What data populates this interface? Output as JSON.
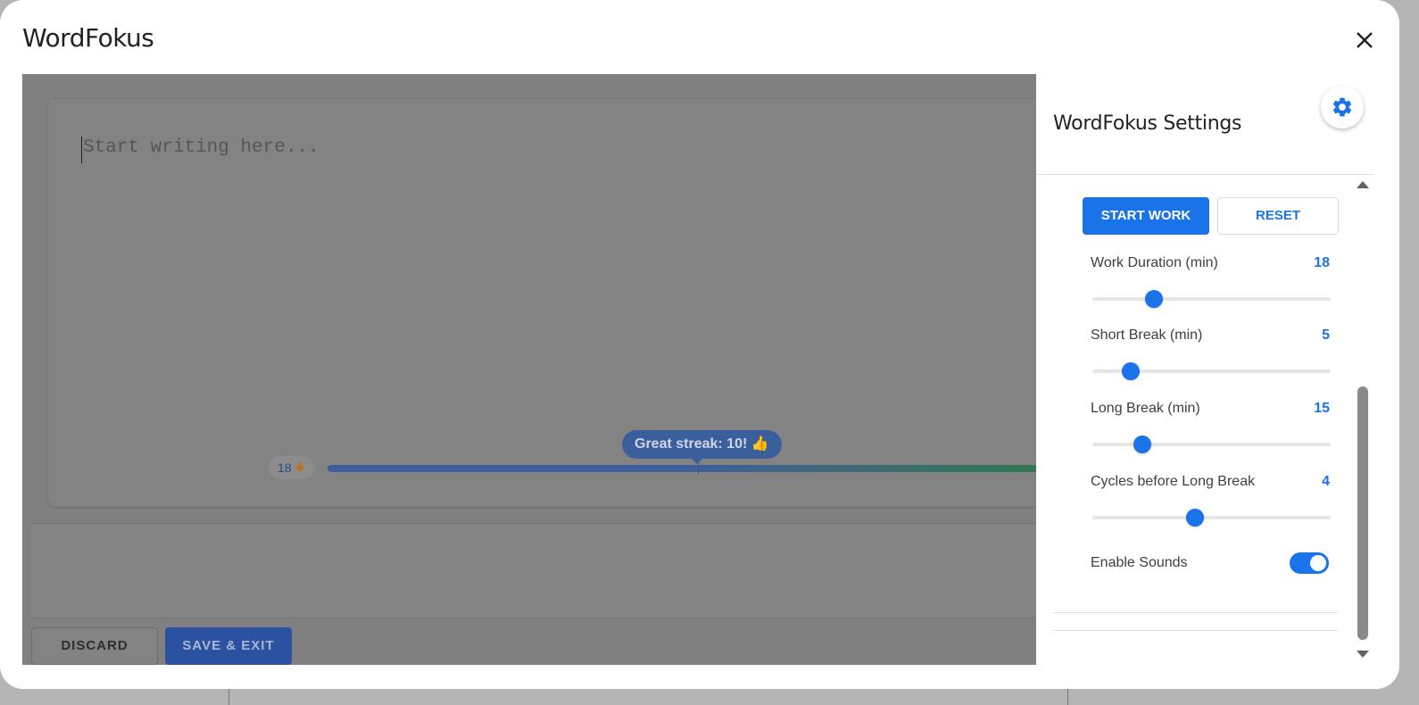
{
  "dialog": {
    "title": "WordFokus"
  },
  "editor": {
    "placeholder": "Start writing here...",
    "streak_count": "18",
    "streak_icon": "flame-icon",
    "streak_tooltip": "Great streak: 10! 👍",
    "progress": 0.5,
    "discard_label": "DISCARD",
    "save_exit_label": "SAVE & EXIT"
  },
  "settings": {
    "title": "WordFokus Settings",
    "start_label": "START WORK",
    "reset_label": "RESET",
    "items": [
      {
        "label": "Work Duration (min)",
        "value": "18",
        "fraction": 0.26
      },
      {
        "label": "Short Break (min)",
        "value": "5",
        "fraction": 0.16
      },
      {
        "label": "Long Break (min)",
        "value": "15",
        "fraction": 0.21
      },
      {
        "label": "Cycles before Long Break",
        "value": "4",
        "fraction": 0.43
      }
    ],
    "sounds_label": "Enable Sounds",
    "sounds_enabled": true
  },
  "colors": {
    "accent": "#1a73e8"
  }
}
